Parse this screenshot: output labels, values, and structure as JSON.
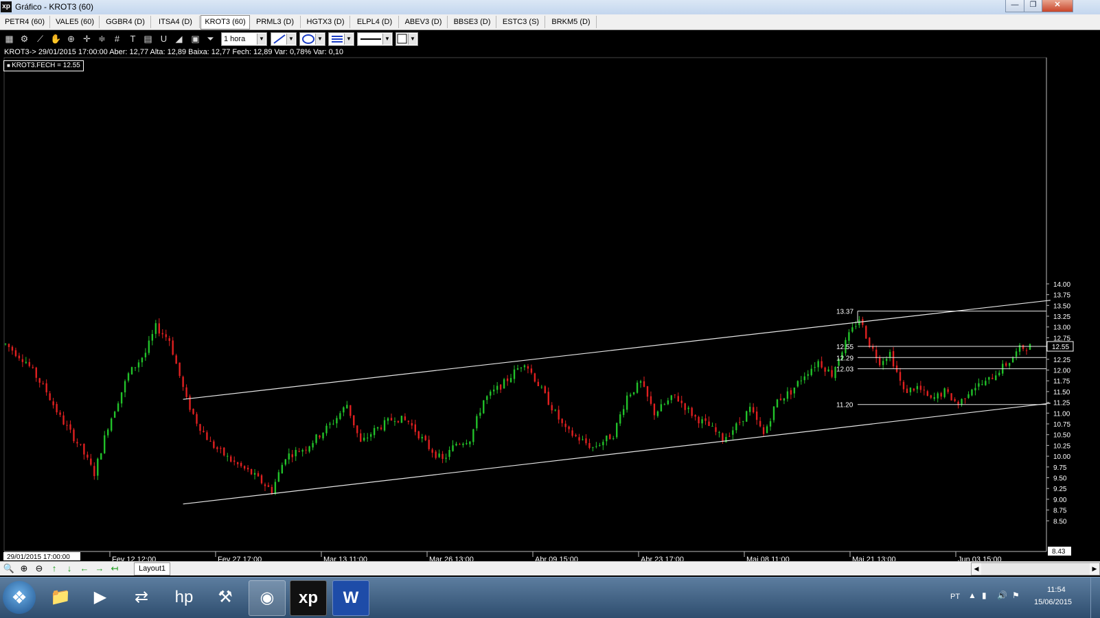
{
  "window": {
    "title": "Gráfico - KROT3 (60)",
    "app_icon_text": "xp",
    "icons": {
      "minimize": "minimize-icon",
      "maximize": "restore-icon",
      "close": "close-icon"
    },
    "button_glyphs": {
      "minimize": "—",
      "restore": "❐",
      "close": "✕"
    }
  },
  "tabs": [
    {
      "label": "PETR4 (60)"
    },
    {
      "label": "VALE5 (60)"
    },
    {
      "label": "GGBR4 (D)"
    },
    {
      "label": "ITSA4 (D)"
    },
    {
      "label": "KROT3 (60)",
      "active": true
    },
    {
      "label": "PRML3 (D)"
    },
    {
      "label": "HGTX3 (D)"
    },
    {
      "label": "ELPL4 (D)"
    },
    {
      "label": "ABEV3 (D)"
    },
    {
      "label": "BBSE3 (D)"
    },
    {
      "label": "ESTC3 (S)"
    },
    {
      "label": "BRKM5 (D)"
    }
  ],
  "toolbar": {
    "tools": [
      {
        "name": "chart-type-icon",
        "glyph": "▦"
      },
      {
        "name": "settings-gear-icon",
        "glyph": "⚙"
      },
      {
        "name": "indicator-icon",
        "glyph": "⟋"
      },
      {
        "name": "hand-pan-icon",
        "glyph": "✋"
      },
      {
        "name": "zoom-area-icon",
        "glyph": "⊕"
      },
      {
        "name": "crosshair-icon",
        "glyph": "✛"
      },
      {
        "name": "fibonacci-icon",
        "glyph": "≑"
      },
      {
        "name": "grid-lines-icon",
        "glyph": "#"
      },
      {
        "name": "text-tool-icon",
        "glyph": "T"
      },
      {
        "name": "calculator-icon",
        "glyph": "▤"
      },
      {
        "name": "magnet-icon",
        "glyph": "U"
      },
      {
        "name": "eraser-icon",
        "glyph": "◢"
      },
      {
        "name": "clipboard-icon",
        "glyph": "▣"
      },
      {
        "name": "filter-icon",
        "glyph": "⏷"
      }
    ],
    "interval": "1 hora",
    "line_tool": "line-draw-icon",
    "shape_tool": "ellipse-icon",
    "line_style": "line-style-icon",
    "line_width": "line-width-icon",
    "color_tool": "color-box-icon"
  },
  "info_line": "KROT3-> 29/01/2015 17:00:00 Aber: 12,77 Alta: 12,89 Baixa: 12,77 Fech: 12,89 Var: 0,78% Var: 0,10",
  "series_legend": "KROT3.FECH = 12.55",
  "chart_data": {
    "type": "candlestick",
    "symbol": "KROT3",
    "ylim": [
      8.43,
      14.1
    ],
    "y_ticks": [
      "14.00",
      "13.75",
      "13.50",
      "13.25",
      "13.00",
      "12.75",
      "12.50",
      "12.25",
      "12.00",
      "11.75",
      "11.50",
      "11.25",
      "11.00",
      "10.75",
      "10.50",
      "10.25",
      "10.00",
      "9.75",
      "9.50",
      "9.25",
      "9.00",
      "8.75",
      "8.50"
    ],
    "min_label": "8.43",
    "last_price_label": "12.55",
    "x_labels": [
      "29/01/2015 17:00:00",
      "Fev 12 12:00",
      "Fev 27 17:00",
      "Mar 13 11:00",
      "Mar 26 13:00",
      "Abr 09 15:00",
      "Abr 23 17:00",
      "Mai 08 11:00",
      "Mai 21 13:00",
      "Jun 03 15:00"
    ],
    "up_color": "#22c22a",
    "down_color": "#e02020",
    "keypoints": [
      [
        0,
        12.6
      ],
      [
        6,
        12.2
      ],
      [
        12,
        11.5
      ],
      [
        16,
        10.9
      ],
      [
        22,
        10.2
      ],
      [
        26,
        9.6
      ],
      [
        30,
        10.7
      ],
      [
        36,
        11.9
      ],
      [
        41,
        12.4
      ],
      [
        44,
        13.0
      ],
      [
        48,
        12.7
      ],
      [
        53,
        11.3
      ],
      [
        56,
        10.8
      ],
      [
        60,
        10.3
      ],
      [
        66,
        9.9
      ],
      [
        72,
        9.6
      ],
      [
        78,
        9.2
      ],
      [
        82,
        10.0
      ],
      [
        88,
        10.2
      ],
      [
        96,
        10.8
      ],
      [
        100,
        11.2
      ],
      [
        104,
        10.3
      ],
      [
        108,
        10.6
      ],
      [
        114,
        10.9
      ],
      [
        118,
        10.8
      ],
      [
        124,
        10.2
      ],
      [
        128,
        9.9
      ],
      [
        132,
        10.3
      ],
      [
        136,
        10.4
      ],
      [
        140,
        11.3
      ],
      [
        146,
        11.7
      ],
      [
        152,
        12.2
      ],
      [
        158,
        11.4
      ],
      [
        164,
        10.6
      ],
      [
        168,
        10.4
      ],
      [
        172,
        10.2
      ],
      [
        178,
        10.5
      ],
      [
        182,
        11.4
      ],
      [
        186,
        11.7
      ],
      [
        190,
        11.0
      ],
      [
        196,
        11.4
      ],
      [
        202,
        10.9
      ],
      [
        206,
        10.7
      ],
      [
        210,
        10.4
      ],
      [
        214,
        10.7
      ],
      [
        218,
        11.1
      ],
      [
        222,
        10.5
      ],
      [
        226,
        11.3
      ],
      [
        230,
        11.5
      ],
      [
        234,
        11.9
      ],
      [
        238,
        12.2
      ],
      [
        242,
        11.9
      ],
      [
        244,
        12.3
      ],
      [
        247,
        12.8
      ],
      [
        250,
        13.2
      ],
      [
        253,
        12.6
      ],
      [
        256,
        12.2
      ],
      [
        259,
        12.4
      ],
      [
        263,
        11.5
      ],
      [
        267,
        11.6
      ],
      [
        271,
        11.3
      ],
      [
        275,
        11.5
      ],
      [
        279,
        11.2
      ],
      [
        283,
        11.6
      ],
      [
        287,
        11.7
      ],
      [
        291,
        12.0
      ],
      [
        294,
        12.2
      ],
      [
        297,
        12.5
      ],
      [
        300,
        12.55
      ]
    ],
    "upper_channel": {
      "from": [
        52,
        11.32
      ],
      "to": [
        306,
        13.62
      ]
    },
    "lower_channel": {
      "from": [
        52,
        8.89
      ],
      "to": [
        306,
        11.23
      ]
    },
    "levels": [
      {
        "label": "13.37",
        "value": 13.37
      },
      {
        "label": "12.55",
        "value": 12.55
      },
      {
        "label": "12.29",
        "value": 12.29
      },
      {
        "label": "12.03",
        "value": 12.03
      },
      {
        "label": "11.20",
        "value": 11.2
      }
    ]
  },
  "bottombar": {
    "nav": [
      {
        "name": "zoom-fit-icon",
        "glyph": "🔍"
      },
      {
        "name": "zoom-in-icon",
        "glyph": "⊕"
      },
      {
        "name": "zoom-out-icon",
        "glyph": "⊖"
      },
      {
        "name": "arrow-up-icon",
        "glyph": "↑"
      },
      {
        "name": "arrow-down-icon",
        "glyph": "↓"
      },
      {
        "name": "arrow-left-icon",
        "glyph": "←"
      },
      {
        "name": "arrow-right-icon",
        "glyph": "→"
      },
      {
        "name": "arrow-end-icon",
        "glyph": "↤"
      }
    ],
    "layout_tab": "Layout1",
    "scroll_left": "◀",
    "scroll_right": "▶"
  },
  "taskbar": {
    "apps": [
      {
        "name": "windows-explorer-icon",
        "glyph": "📁"
      },
      {
        "name": "media-player-icon",
        "glyph": "▶"
      },
      {
        "name": "network-sharing-icon",
        "glyph": "⇄"
      },
      {
        "name": "hp-icon",
        "glyph": "hp"
      },
      {
        "name": "tools-icon",
        "glyph": "⚒"
      },
      {
        "name": "chrome-icon",
        "glyph": "◉"
      },
      {
        "name": "xp-investimentos-icon",
        "glyph": "xp"
      },
      {
        "name": "word-icon",
        "glyph": "W"
      }
    ],
    "start_glyph": "❖",
    "language": "PT",
    "tray": [
      {
        "name": "show-hidden-icons-icon",
        "glyph": "▲"
      },
      {
        "name": "signal-icon",
        "glyph": "▮"
      },
      {
        "name": "volume-icon",
        "glyph": "🔊"
      },
      {
        "name": "action-center-icon",
        "glyph": "⚑"
      }
    ],
    "time": "11:54",
    "date": "15/06/2015"
  }
}
